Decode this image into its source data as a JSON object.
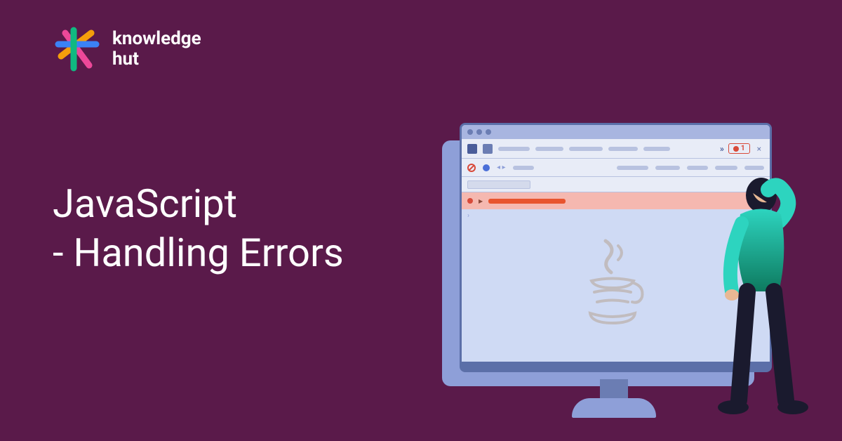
{
  "logo": {
    "line1": "knowledge",
    "line2": "hut"
  },
  "title": {
    "line1": "JavaScript",
    "line2": "- Handling Errors"
  },
  "devtools": {
    "error_count": "1",
    "chevrons": "»"
  },
  "colors": {
    "background": "#5a1a4a",
    "accent_red": "#d84a3a",
    "accent_orange": "#e8542e",
    "monitor_light": "#cfdaf4",
    "monitor_mid": "#8e9fd8",
    "monitor_dark": "#5b6fa8"
  }
}
